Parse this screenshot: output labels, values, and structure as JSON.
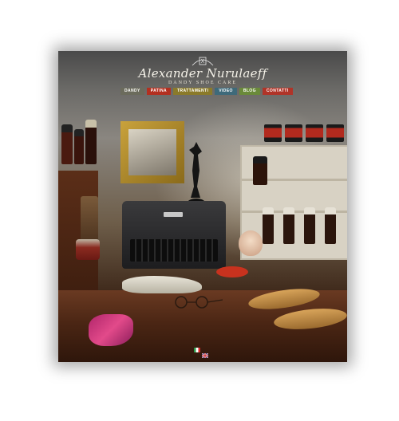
{
  "brand": {
    "name": "Alexander Nurulaeff",
    "tagline": "DANDY SHOE CARE"
  },
  "nav": {
    "items": [
      {
        "label": "DANDY",
        "color": "#6b6b5c"
      },
      {
        "label": "PATINA",
        "color": "#b33020"
      },
      {
        "label": "TRATTAMENTI",
        "color": "#8a7a2a"
      },
      {
        "label": "VIDEO",
        "color": "#3e6a7a"
      },
      {
        "label": "BLOG",
        "color": "#6a8a3a"
      },
      {
        "label": "CONTATTI",
        "color": "#b03428"
      }
    ]
  },
  "languages": [
    {
      "code": "it",
      "icon": "flag-italy-icon"
    },
    {
      "code": "en",
      "icon": "flag-uk-icon"
    }
  ]
}
